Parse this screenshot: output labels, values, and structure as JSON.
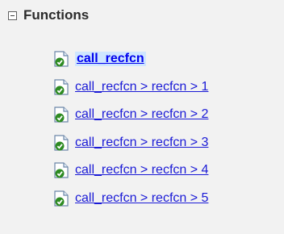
{
  "header": {
    "title": "Functions",
    "collapse_icon": "collapse-minus-icon"
  },
  "items": [
    {
      "label": "call_recfcn",
      "icon": "file-check-icon",
      "selected": true
    },
    {
      "label": "call_recfcn > recfcn > 1",
      "icon": "file-check-icon",
      "selected": false
    },
    {
      "label": "call_recfcn > recfcn > 2",
      "icon": "file-check-icon",
      "selected": false
    },
    {
      "label": "call_recfcn > recfcn > 3",
      "icon": "file-check-icon",
      "selected": false
    },
    {
      "label": "call_recfcn > recfcn > 4",
      "icon": "file-check-icon",
      "selected": false
    },
    {
      "label": "call_recfcn > recfcn > 5",
      "icon": "file-check-icon",
      "selected": false
    }
  ],
  "colors": {
    "link": "#1a1ad6",
    "check": "#2e8b22",
    "selection": "#cfe6ff"
  }
}
